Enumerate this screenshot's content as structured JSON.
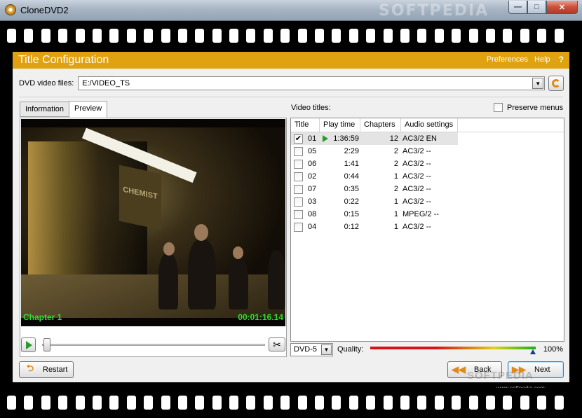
{
  "window": {
    "title": "CloneDVD2",
    "watermark": "SOFTPEDIA",
    "controls": {
      "minimize": "—",
      "maximize": "□",
      "close": "✕"
    }
  },
  "header": {
    "title": "Title Configuration",
    "preferences": "Preferences",
    "help": "Help",
    "help_icon": "?"
  },
  "source": {
    "label": "DVD video files:",
    "value": "E:/VIDEO_TS",
    "browse_icon": "refresh-icon"
  },
  "tabs": [
    {
      "label": "Information",
      "active": false
    },
    {
      "label": "Preview",
      "active": true
    }
  ],
  "preview": {
    "sign_text": "CHEMIST",
    "chapter_overlay": "Chapter 1",
    "time_overlay": "00:01:16.14",
    "scissor_icon": "✂"
  },
  "titles": {
    "label": "Video titles:",
    "preserve_menus": {
      "label": "Preserve menus",
      "checked": false
    },
    "columns": [
      "Title",
      "Play time",
      "Chapters",
      "Audio settings"
    ],
    "rows": [
      {
        "checked": true,
        "playing": true,
        "title": "01",
        "play_time": "1:36:59",
        "chapters": "12",
        "audio": "AC3/2 EN"
      },
      {
        "checked": false,
        "playing": false,
        "title": "05",
        "play_time": "2:29",
        "chapters": "2",
        "audio": "AC3/2 --"
      },
      {
        "checked": false,
        "playing": false,
        "title": "06",
        "play_time": "1:41",
        "chapters": "2",
        "audio": "AC3/2 --"
      },
      {
        "checked": false,
        "playing": false,
        "title": "02",
        "play_time": "0:44",
        "chapters": "1",
        "audio": "AC3/2 --"
      },
      {
        "checked": false,
        "playing": false,
        "title": "07",
        "play_time": "0:35",
        "chapters": "2",
        "audio": "AC3/2 --"
      },
      {
        "checked": false,
        "playing": false,
        "title": "03",
        "play_time": "0:22",
        "chapters": "1",
        "audio": "AC3/2 --"
      },
      {
        "checked": false,
        "playing": false,
        "title": "08",
        "play_time": "0:15",
        "chapters": "1",
        "audio": "MPEG/2 --"
      },
      {
        "checked": false,
        "playing": false,
        "title": "04",
        "play_time": "0:12",
        "chapters": "1",
        "audio": "AC3/2 --"
      }
    ]
  },
  "output": {
    "format": "DVD-5",
    "quality_label": "Quality:",
    "quality_value": "100%",
    "quality_fraction": 1.0
  },
  "buttons": {
    "restart": "Restart",
    "back": "Back",
    "next": "Next"
  },
  "softpedia_watermark": "SOFTPEDIA",
  "softpedia_url": "www.softpedia.com",
  "colors": {
    "accent": "#e0a210",
    "overlay_text": "#2fe02f"
  }
}
